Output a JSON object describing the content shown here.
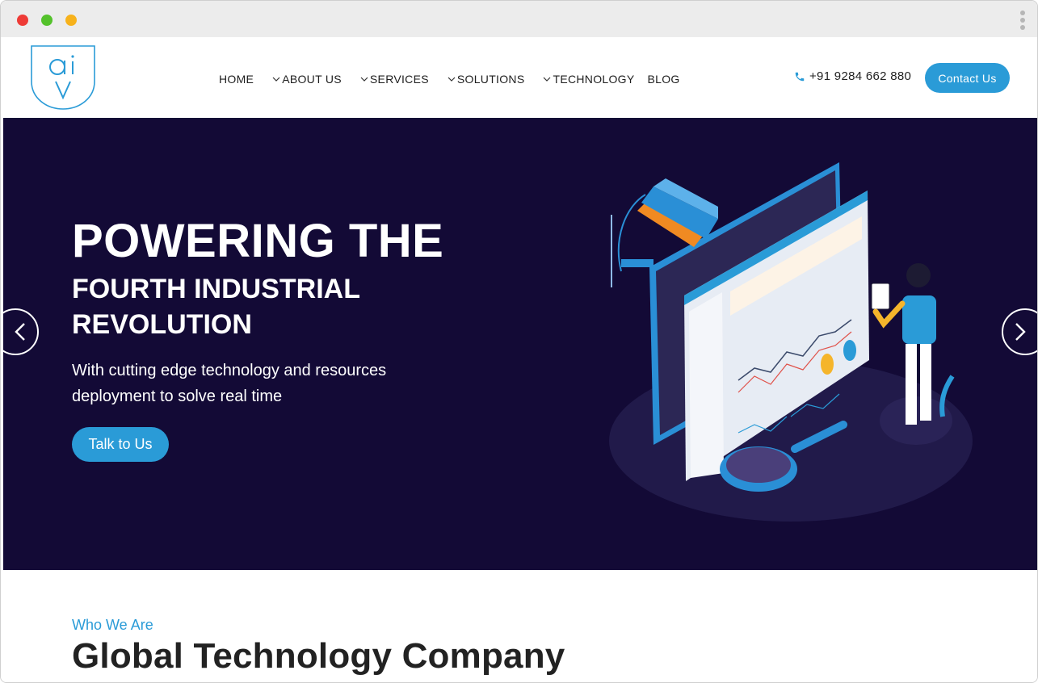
{
  "header": {
    "nav": [
      {
        "label": "HOME",
        "dropdown": false
      },
      {
        "label": "ABOUT US",
        "dropdown": true
      },
      {
        "label": "SERVICES",
        "dropdown": true
      },
      {
        "label": "SOLUTIONS",
        "dropdown": true
      },
      {
        "label": "TECHNOLOGY",
        "dropdown": true
      },
      {
        "label": "BLOG",
        "dropdown": false
      }
    ],
    "phone": "+91 9284 662 880",
    "contact_label": "Contact Us",
    "logo_text": "ai v"
  },
  "hero": {
    "title": "POWERING THE",
    "subtitle": "FOURTH INDUSTRIAL REVOLUTION",
    "description": "With cutting edge technology and resources deployment to solve real time",
    "cta_label": "Talk to Us"
  },
  "about": {
    "eyebrow": "Who We Are",
    "title": "Global Technology Company"
  },
  "colors": {
    "accent": "#2a9bd7",
    "hero_bg": "#130a36",
    "text_dark": "#222222"
  },
  "icons": {
    "phone": "phone-icon",
    "prev": "chevron-left-icon",
    "next": "chevron-right-icon",
    "dropdown": "chevron-down-icon"
  }
}
